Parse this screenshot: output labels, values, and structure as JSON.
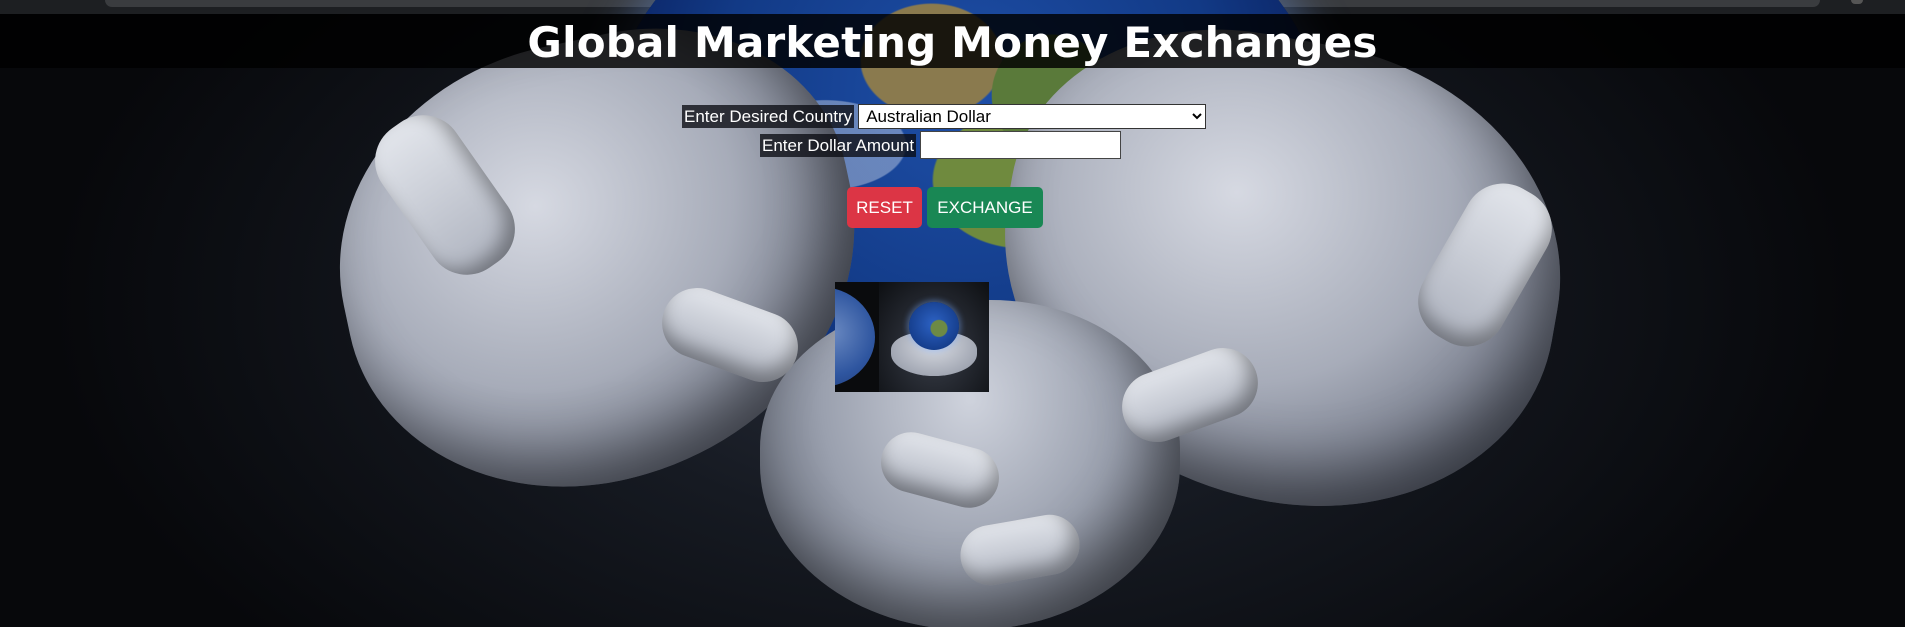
{
  "page": {
    "title": "Global Marketing Money Exchanges"
  },
  "form": {
    "country_label": "Enter Desired Country",
    "country_selected": "Australian Dollar",
    "amount_label": "Enter Dollar Amount",
    "amount_value": "",
    "reset_label": "RESET",
    "exchange_label": "EXCHANGE"
  },
  "colors": {
    "reset_button": "#dc3545",
    "exchange_button": "#198754",
    "title_band": "#000000"
  }
}
